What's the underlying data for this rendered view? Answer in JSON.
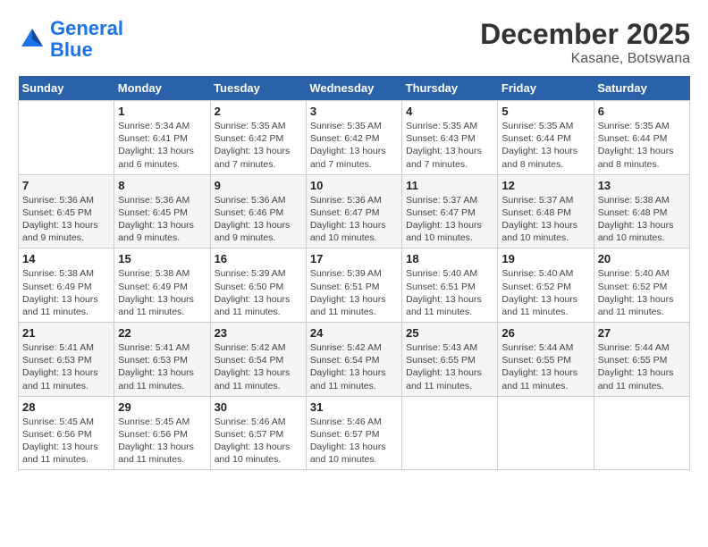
{
  "header": {
    "logo_line1": "General",
    "logo_line2": "Blue",
    "month": "December 2025",
    "location": "Kasane, Botswana"
  },
  "weekdays": [
    "Sunday",
    "Monday",
    "Tuesday",
    "Wednesday",
    "Thursday",
    "Friday",
    "Saturday"
  ],
  "weeks": [
    [
      {
        "day": "",
        "info": ""
      },
      {
        "day": "1",
        "info": "Sunrise: 5:34 AM\nSunset: 6:41 PM\nDaylight: 13 hours\nand 6 minutes."
      },
      {
        "day": "2",
        "info": "Sunrise: 5:35 AM\nSunset: 6:42 PM\nDaylight: 13 hours\nand 7 minutes."
      },
      {
        "day": "3",
        "info": "Sunrise: 5:35 AM\nSunset: 6:42 PM\nDaylight: 13 hours\nand 7 minutes."
      },
      {
        "day": "4",
        "info": "Sunrise: 5:35 AM\nSunset: 6:43 PM\nDaylight: 13 hours\nand 7 minutes."
      },
      {
        "day": "5",
        "info": "Sunrise: 5:35 AM\nSunset: 6:44 PM\nDaylight: 13 hours\nand 8 minutes."
      },
      {
        "day": "6",
        "info": "Sunrise: 5:35 AM\nSunset: 6:44 PM\nDaylight: 13 hours\nand 8 minutes."
      }
    ],
    [
      {
        "day": "7",
        "info": "Sunrise: 5:36 AM\nSunset: 6:45 PM\nDaylight: 13 hours\nand 9 minutes."
      },
      {
        "day": "8",
        "info": "Sunrise: 5:36 AM\nSunset: 6:45 PM\nDaylight: 13 hours\nand 9 minutes."
      },
      {
        "day": "9",
        "info": "Sunrise: 5:36 AM\nSunset: 6:46 PM\nDaylight: 13 hours\nand 9 minutes."
      },
      {
        "day": "10",
        "info": "Sunrise: 5:36 AM\nSunset: 6:47 PM\nDaylight: 13 hours\nand 10 minutes."
      },
      {
        "day": "11",
        "info": "Sunrise: 5:37 AM\nSunset: 6:47 PM\nDaylight: 13 hours\nand 10 minutes."
      },
      {
        "day": "12",
        "info": "Sunrise: 5:37 AM\nSunset: 6:48 PM\nDaylight: 13 hours\nand 10 minutes."
      },
      {
        "day": "13",
        "info": "Sunrise: 5:38 AM\nSunset: 6:48 PM\nDaylight: 13 hours\nand 10 minutes."
      }
    ],
    [
      {
        "day": "14",
        "info": "Sunrise: 5:38 AM\nSunset: 6:49 PM\nDaylight: 13 hours\nand 11 minutes."
      },
      {
        "day": "15",
        "info": "Sunrise: 5:38 AM\nSunset: 6:49 PM\nDaylight: 13 hours\nand 11 minutes."
      },
      {
        "day": "16",
        "info": "Sunrise: 5:39 AM\nSunset: 6:50 PM\nDaylight: 13 hours\nand 11 minutes."
      },
      {
        "day": "17",
        "info": "Sunrise: 5:39 AM\nSunset: 6:51 PM\nDaylight: 13 hours\nand 11 minutes."
      },
      {
        "day": "18",
        "info": "Sunrise: 5:40 AM\nSunset: 6:51 PM\nDaylight: 13 hours\nand 11 minutes."
      },
      {
        "day": "19",
        "info": "Sunrise: 5:40 AM\nSunset: 6:52 PM\nDaylight: 13 hours\nand 11 minutes."
      },
      {
        "day": "20",
        "info": "Sunrise: 5:40 AM\nSunset: 6:52 PM\nDaylight: 13 hours\nand 11 minutes."
      }
    ],
    [
      {
        "day": "21",
        "info": "Sunrise: 5:41 AM\nSunset: 6:53 PM\nDaylight: 13 hours\nand 11 minutes."
      },
      {
        "day": "22",
        "info": "Sunrise: 5:41 AM\nSunset: 6:53 PM\nDaylight: 13 hours\nand 11 minutes."
      },
      {
        "day": "23",
        "info": "Sunrise: 5:42 AM\nSunset: 6:54 PM\nDaylight: 13 hours\nand 11 minutes."
      },
      {
        "day": "24",
        "info": "Sunrise: 5:42 AM\nSunset: 6:54 PM\nDaylight: 13 hours\nand 11 minutes."
      },
      {
        "day": "25",
        "info": "Sunrise: 5:43 AM\nSunset: 6:55 PM\nDaylight: 13 hours\nand 11 minutes."
      },
      {
        "day": "26",
        "info": "Sunrise: 5:44 AM\nSunset: 6:55 PM\nDaylight: 13 hours\nand 11 minutes."
      },
      {
        "day": "27",
        "info": "Sunrise: 5:44 AM\nSunset: 6:55 PM\nDaylight: 13 hours\nand 11 minutes."
      }
    ],
    [
      {
        "day": "28",
        "info": "Sunrise: 5:45 AM\nSunset: 6:56 PM\nDaylight: 13 hours\nand 11 minutes."
      },
      {
        "day": "29",
        "info": "Sunrise: 5:45 AM\nSunset: 6:56 PM\nDaylight: 13 hours\nand 11 minutes."
      },
      {
        "day": "30",
        "info": "Sunrise: 5:46 AM\nSunset: 6:57 PM\nDaylight: 13 hours\nand 10 minutes."
      },
      {
        "day": "31",
        "info": "Sunrise: 5:46 AM\nSunset: 6:57 PM\nDaylight: 13 hours\nand 10 minutes."
      },
      {
        "day": "",
        "info": ""
      },
      {
        "day": "",
        "info": ""
      },
      {
        "day": "",
        "info": ""
      }
    ]
  ]
}
